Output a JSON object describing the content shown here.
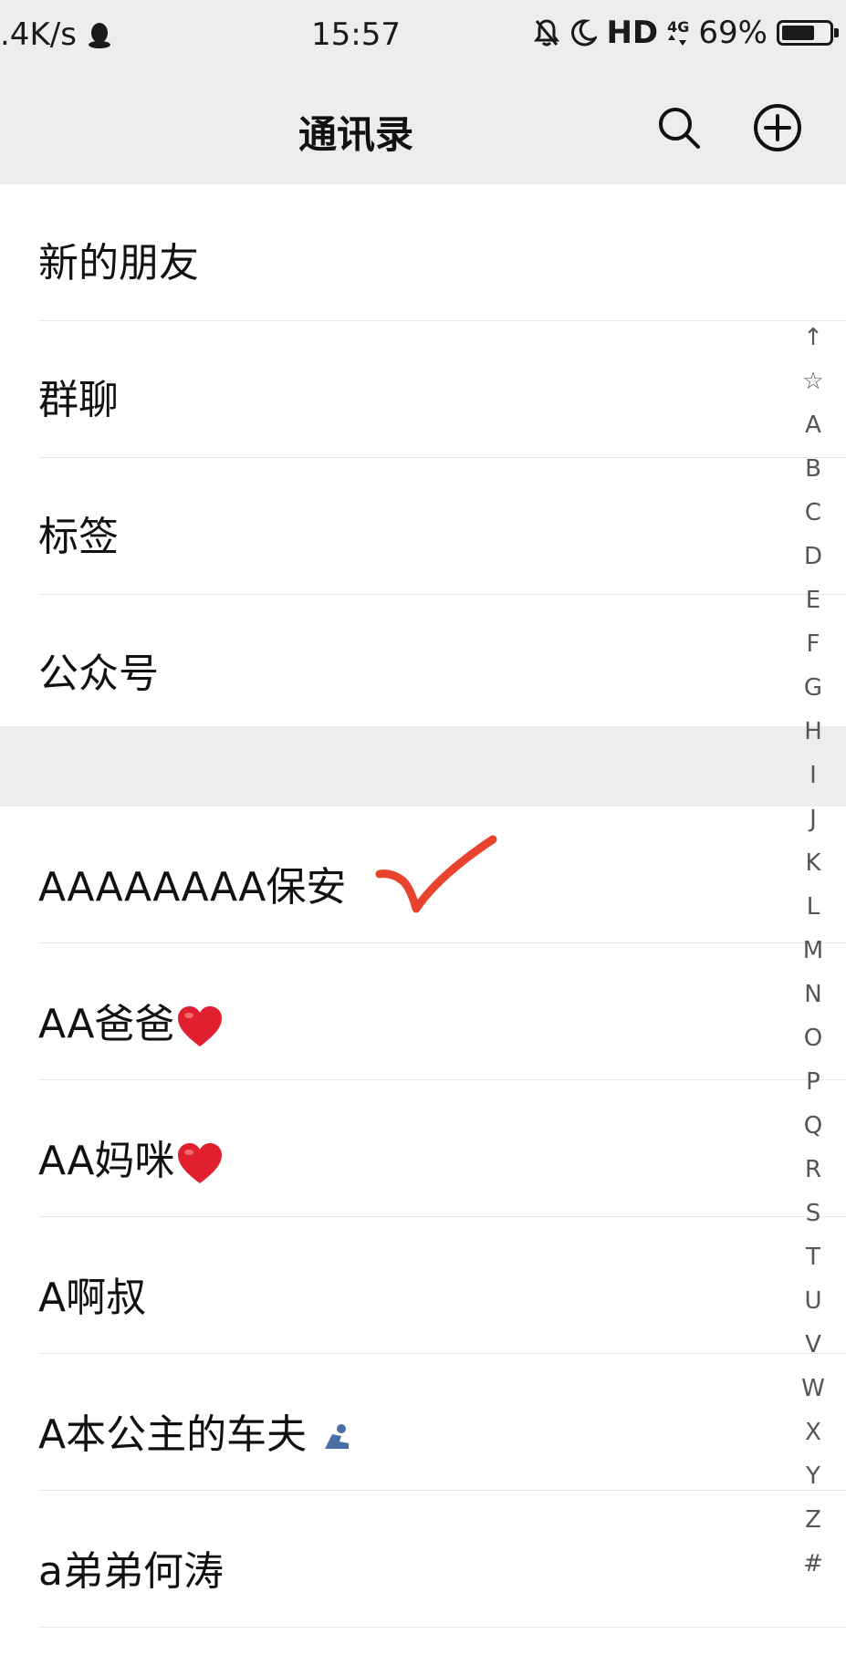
{
  "status_bar": {
    "net_speed": ".4K/s",
    "time": "15:57",
    "hd": "HD",
    "network": "4G",
    "battery": "69%",
    "battery_level": 0.69
  },
  "header": {
    "title": "通讯录",
    "search_icon": "search-icon",
    "add_icon": "plus-circle-icon"
  },
  "menu": [
    {
      "label": "新的朋友"
    },
    {
      "label": "群聊"
    },
    {
      "label": "标签"
    },
    {
      "label": "公众号"
    }
  ],
  "contacts": [
    {
      "name": "AAAAAAAA保安",
      "annotation": "red-checkmark"
    },
    {
      "name": "AA爸爸",
      "emoji": "heart-emoji"
    },
    {
      "name": "AA妈咪",
      "emoji": "heart-emoji"
    },
    {
      "name": "A啊叔"
    },
    {
      "name": "A本公主的车夫",
      "emoji": "person-emoji"
    },
    {
      "name": "a弟弟何涛"
    }
  ],
  "index_letters": [
    "↑",
    "☆",
    "A",
    "B",
    "C",
    "D",
    "E",
    "F",
    "G",
    "H",
    "I",
    "J",
    "K",
    "L",
    "M",
    "N",
    "O",
    "P",
    "Q",
    "R",
    "S",
    "T",
    "U",
    "V",
    "W",
    "X",
    "Y",
    "Z",
    "#"
  ],
  "colors": {
    "header_bg": "#ededed",
    "heart": "#e0202e",
    "checkmark": "#e8432d",
    "person_emoji": "#4a6fa5"
  }
}
